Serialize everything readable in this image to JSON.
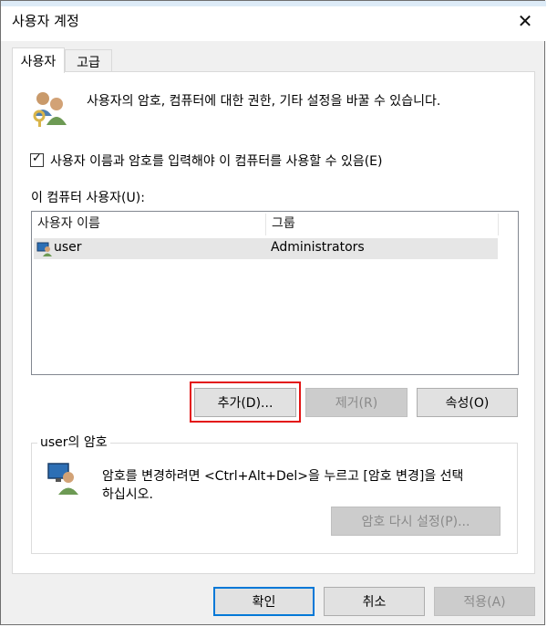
{
  "window": {
    "title": "사용자 계정",
    "close_glyph": "✕"
  },
  "tabs": [
    {
      "label": "사용자"
    },
    {
      "label": "고급"
    }
  ],
  "intro_text": "사용자의 암호, 컴퓨터에 대한 권한, 기타 설정을 바꿀 수 있습니다.",
  "require_login": {
    "label": "사용자 이름과 암호를 입력해야 이 컴퓨터를 사용할 수 있음(E)",
    "checked": true,
    "check_glyph": "✓"
  },
  "users_list": {
    "label": "이 컴퓨터 사용자(U):",
    "columns": [
      "사용자 이름",
      "그룹"
    ],
    "rows": [
      {
        "name": "user",
        "group": "Administrators"
      }
    ]
  },
  "list_buttons": {
    "add": "추가(D)...",
    "remove": "제거(R)",
    "properties": "속성(O)"
  },
  "password_group": {
    "title": "user의 암호",
    "text_line1": "암호를 변경하려면 <Ctrl+Alt+Del>을 누르고 [암호 변경]을 선택",
    "text_line2": "하십시오.",
    "reset_button": "암호 다시 설정(P)..."
  },
  "footer_buttons": {
    "ok": "확인",
    "cancel": "취소",
    "apply": "적용(A)"
  },
  "colors": {
    "accent": "#0078d7",
    "highlight_box": "#e31414"
  },
  "icons": {
    "users_icon": "users-keys-icon",
    "user_row_icon": "user-account-icon",
    "password_icon": "user-monitor-icon"
  }
}
